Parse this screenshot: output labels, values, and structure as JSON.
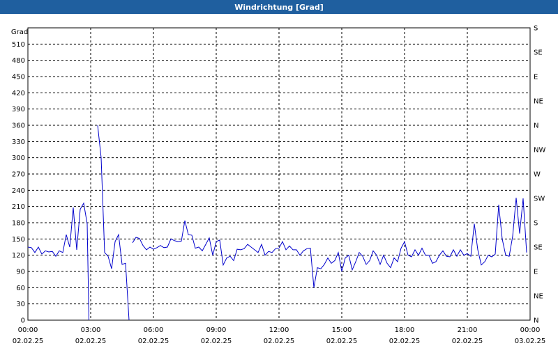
{
  "window": {
    "title": "Windrichtung [Grad]"
  },
  "chart_data": {
    "type": "line",
    "title": "Windrichtung [Grad]",
    "ylabel": "Grad",
    "ylim": [
      0,
      540
    ],
    "yticks": [
      0,
      30,
      60,
      90,
      120,
      150,
      180,
      210,
      240,
      270,
      300,
      330,
      360,
      390,
      420,
      450,
      480,
      510
    ],
    "right_axis_labels": [
      "N",
      "NE",
      "E",
      "SE",
      "S",
      "SW",
      "W",
      "NW",
      "N",
      "NE",
      "E",
      "SE",
      "S"
    ],
    "x_ticks": [
      {
        "time": "00:00",
        "date": "02.02.25"
      },
      {
        "time": "03:00",
        "date": "02.02.25"
      },
      {
        "time": "06:00",
        "date": "02.02.25"
      },
      {
        "time": "09:00",
        "date": "02.02.25"
      },
      {
        "time": "12:00",
        "date": "02.02.25"
      },
      {
        "time": "15:00",
        "date": "02.02.25"
      },
      {
        "time": "18:00",
        "date": "02.02.25"
      },
      {
        "time": "21:00",
        "date": "02.02.25"
      },
      {
        "time": "00:00",
        "date": "03.02.25"
      }
    ],
    "grid": true,
    "series": [
      {
        "color": "#0000cc",
        "segments": [
          [
            [
              "00:00",
              135
            ],
            [
              "00:10",
              134
            ],
            [
              "00:20",
              125
            ],
            [
              "00:30",
              135
            ],
            [
              "00:40",
              122
            ],
            [
              "00:50",
              128
            ],
            [
              "01:00",
              126
            ],
            [
              "01:10",
              127
            ],
            [
              "01:20",
              118
            ],
            [
              "01:30",
              128
            ],
            [
              "01:40",
              125
            ],
            [
              "01:50",
              158
            ],
            [
              "02:00",
              135
            ],
            [
              "02:10",
              208
            ],
            [
              "02:20",
              130
            ],
            [
              "02:30",
              205
            ],
            [
              "02:40",
              216
            ],
            [
              "02:50",
              178
            ],
            [
              "02:55",
              0
            ]
          ],
          [
            [
              "03:20",
              360
            ],
            [
              "03:30",
              300
            ],
            [
              "03:40",
              125
            ],
            [
              "03:50",
              118
            ],
            [
              "04:00",
              95
            ],
            [
              "04:10",
              145
            ],
            [
              "04:20",
              158
            ],
            [
              "04:30",
              103
            ],
            [
              "04:40",
              105
            ],
            [
              "04:50",
              0
            ]
          ],
          [
            [
              "05:00",
              143
            ],
            [
              "05:10",
              153
            ],
            [
              "05:20",
              151
            ],
            [
              "05:30",
              138
            ],
            [
              "05:40",
              130
            ],
            [
              "05:50",
              135
            ],
            [
              "06:00",
              131
            ],
            [
              "06:10",
              134
            ],
            [
              "06:20",
              138
            ],
            [
              "06:30",
              134
            ],
            [
              "06:40",
              135
            ],
            [
              "06:50",
              150
            ],
            [
              "07:00",
              147
            ],
            [
              "07:10",
              145
            ],
            [
              "07:20",
              146
            ],
            [
              "07:30",
              184
            ],
            [
              "07:40",
              158
            ],
            [
              "07:50",
              157
            ],
            [
              "08:00",
              133
            ],
            [
              "08:10",
              135
            ],
            [
              "08:20",
              128
            ],
            [
              "08:30",
              140
            ],
            [
              "08:40",
              152
            ],
            [
              "08:50",
              120
            ],
            [
              "09:00",
              145
            ],
            [
              "09:10",
              148
            ],
            [
              "09:20",
              102
            ],
            [
              "09:30",
              115
            ],
            [
              "09:40",
              118
            ],
            [
              "09:50",
              110
            ],
            [
              "10:00",
              131
            ],
            [
              "10:10",
              130
            ],
            [
              "10:20",
              132
            ],
            [
              "10:30",
              140
            ],
            [
              "10:40",
              135
            ],
            [
              "10:50",
              130
            ],
            [
              "11:00",
              125
            ],
            [
              "11:10",
              140
            ],
            [
              "11:20",
              120
            ],
            [
              "11:30",
              127
            ],
            [
              "11:40",
              125
            ],
            [
              "11:50",
              132
            ],
            [
              "12:00",
              133
            ],
            [
              "12:10",
              145
            ],
            [
              "12:20",
              130
            ],
            [
              "12:30",
              137
            ],
            [
              "12:40",
              130
            ],
            [
              "12:50",
              130
            ],
            [
              "13:00",
              120
            ],
            [
              "13:10",
              128
            ],
            [
              "13:20",
              132
            ],
            [
              "13:30",
              133
            ],
            [
              "13:40",
              60
            ],
            [
              "13:50",
              97
            ],
            [
              "14:00",
              95
            ],
            [
              "14:10",
              103
            ],
            [
              "14:20",
              115
            ],
            [
              "14:30",
              105
            ],
            [
              "14:40",
              110
            ],
            [
              "14:50",
              125
            ],
            [
              "15:00",
              90
            ],
            [
              "15:10",
              115
            ],
            [
              "15:20",
              120
            ],
            [
              "15:30",
              93
            ],
            [
              "15:40",
              108
            ],
            [
              "15:50",
              125
            ],
            [
              "16:00",
              118
            ],
            [
              "16:10",
              103
            ],
            [
              "16:20",
              110
            ],
            [
              "16:30",
              128
            ],
            [
              "16:40",
              120
            ],
            [
              "16:50",
              103
            ],
            [
              "17:00",
              120
            ],
            [
              "17:10",
              105
            ],
            [
              "17:20",
              97
            ],
            [
              "17:30",
              115
            ],
            [
              "17:40",
              108
            ],
            [
              "17:50",
              133
            ],
            [
              "18:00",
              145
            ],
            [
              "18:10",
              120
            ],
            [
              "18:20",
              117
            ],
            [
              "18:30",
              130
            ],
            [
              "18:40",
              120
            ],
            [
              "18:50",
              133
            ],
            [
              "19:00",
              120
            ],
            [
              "19:10",
              120
            ],
            [
              "19:20",
              105
            ],
            [
              "19:30",
              108
            ],
            [
              "19:40",
              120
            ],
            [
              "19:50",
              128
            ],
            [
              "20:00",
              118
            ],
            [
              "20:10",
              117
            ],
            [
              "20:20",
              130
            ],
            [
              "20:30",
              118
            ],
            [
              "20:40",
              130
            ],
            [
              "20:50",
              120
            ],
            [
              "21:00",
              123
            ],
            [
              "21:10",
              118
            ],
            [
              "21:20",
              178
            ],
            [
              "21:30",
              130
            ],
            [
              "21:40",
              102
            ],
            [
              "21:50",
              108
            ],
            [
              "22:00",
              120
            ],
            [
              "22:10",
              117
            ],
            [
              "22:20",
              122
            ],
            [
              "22:30",
              213
            ],
            [
              "22:40",
              150
            ],
            [
              "22:50",
              120
            ],
            [
              "23:00",
              118
            ],
            [
              "23:10",
              155
            ],
            [
              "23:20",
              226
            ],
            [
              "23:30",
              160
            ],
            [
              "23:40",
              225
            ],
            [
              "23:50",
              125
            ]
          ]
        ]
      }
    ]
  }
}
